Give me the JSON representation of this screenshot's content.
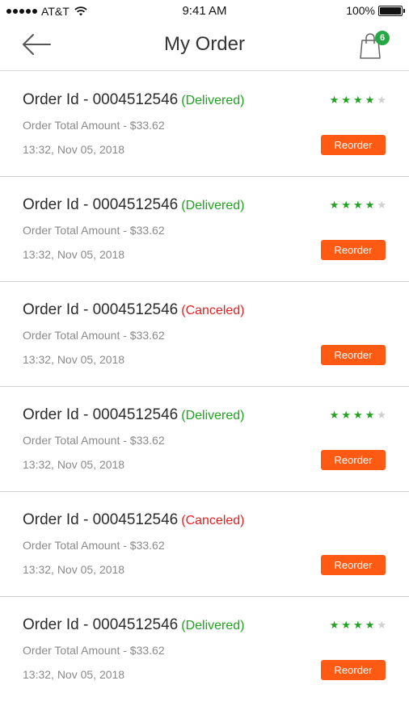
{
  "status_bar": {
    "carrier": "AT&T",
    "time": "9:41 AM",
    "battery": "100%"
  },
  "header": {
    "title": "My Order",
    "back_icon": "back-arrow-icon",
    "cart_icon": "shopping-bag-icon",
    "cart_count": "6"
  },
  "colors": {
    "accent": "#ff5a14",
    "delivered": "#1fa21f",
    "canceled": "#e81e1e",
    "badge": "#28a745"
  },
  "orders": [
    {
      "title": "Order Id - 0004512546",
      "status": "(Delivered)",
      "status_type": "delivered",
      "amount": "Order Total Amount - $33.62",
      "date": "13:32, Nov 05, 2018",
      "rating": 4,
      "rating_max": 5,
      "button": "Reorder"
    },
    {
      "title": "Order Id - 0004512546",
      "status": "(Delivered)",
      "status_type": "delivered",
      "amount": "Order Total Amount - $33.62",
      "date": "13:32, Nov 05, 2018",
      "rating": 4,
      "rating_max": 5,
      "button": "Reorder"
    },
    {
      "title": "Order Id - 0004512546",
      "status": "(Canceled)",
      "status_type": "canceled",
      "amount": "Order Total Amount - $33.62",
      "date": "13:32, Nov 05, 2018",
      "rating": 0,
      "rating_max": 0,
      "button": "Reorder"
    },
    {
      "title": "Order Id - 0004512546",
      "status": "(Delivered)",
      "status_type": "delivered",
      "amount": "Order Total Amount - $33.62",
      "date": "13:32, Nov 05, 2018",
      "rating": 4,
      "rating_max": 5,
      "button": "Reorder"
    },
    {
      "title": "Order Id - 0004512546",
      "status": "(Canceled)",
      "status_type": "canceled",
      "amount": "Order Total Amount - $33.62",
      "date": "13:32, Nov 05, 2018",
      "rating": 0,
      "rating_max": 0,
      "button": "Reorder"
    },
    {
      "title": "Order Id - 0004512546",
      "status": "(Delivered)",
      "status_type": "delivered",
      "amount": "Order Total Amount - $33.62",
      "date": "13:32, Nov 05, 2018",
      "rating": 4,
      "rating_max": 5,
      "button": "Reorder"
    }
  ]
}
